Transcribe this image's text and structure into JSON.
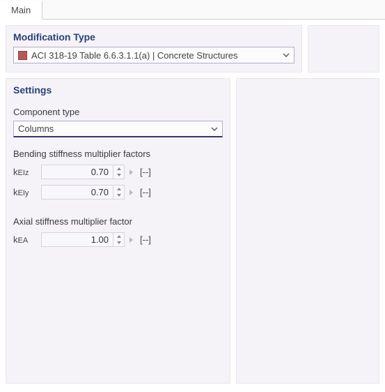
{
  "tab": {
    "main": "Main"
  },
  "modification": {
    "title": "Modification Type",
    "selected": "ACI 318-19 Table 6.6.3.1.1(a) | Concrete Structures"
  },
  "settings": {
    "title": "Settings",
    "component_type_label": "Component type",
    "component_type_value": "Columns",
    "bending_section": "Bending stiffness multiplier factors",
    "axial_section": "Axial stiffness multiplier factor",
    "kEIz": {
      "label_k": "k",
      "label_sub": "EIz",
      "value": "0.70",
      "unit": "[--]"
    },
    "kEIy": {
      "label_k": "k",
      "label_sub": "EIy",
      "value": "0.70",
      "unit": "[--]"
    },
    "kEA": {
      "label_k": "k",
      "label_sub": "EA",
      "value": "1.00",
      "unit": "[--]"
    }
  }
}
